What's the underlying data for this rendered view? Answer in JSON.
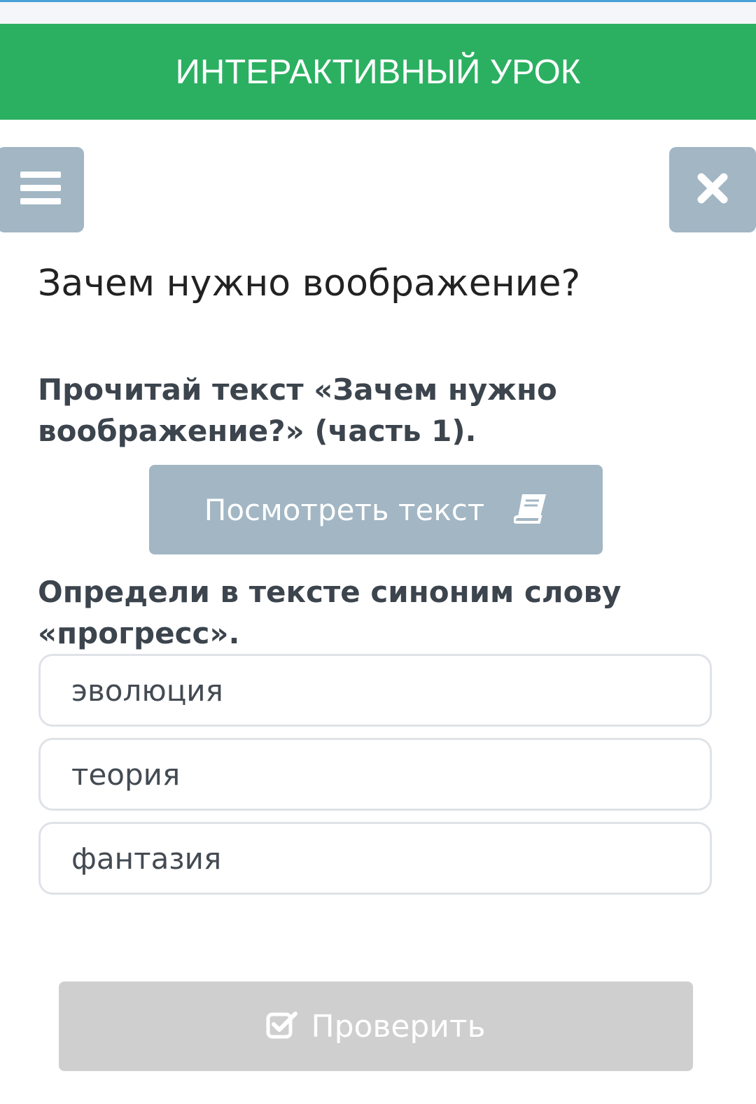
{
  "header": {
    "title": "ИНТЕРАКТИВНЫЙ УРОК"
  },
  "toolbar": {
    "menu_icon": "hamburger-menu-icon",
    "close_icon": "close-icon"
  },
  "question": {
    "title": "Зачем нужно воображение?",
    "instruction_read": "Прочитай текст «Зачем нужно воображение?» (часть 1).",
    "view_text_button": "Посмотреть текст",
    "view_text_icon": "book-icon",
    "instruction_task": "Определи в тексте синоним слову «прогресс».",
    "options": [
      "эволюция",
      "теория",
      "фантазия"
    ]
  },
  "footer": {
    "check_button": "Проверить",
    "check_icon": "checkbox-check-icon"
  },
  "colors": {
    "header": "#2bb061",
    "icon_button": "#a2b6c4",
    "check_button_disabled": "#cfcfcf",
    "option_border": "#dfe3e7"
  }
}
